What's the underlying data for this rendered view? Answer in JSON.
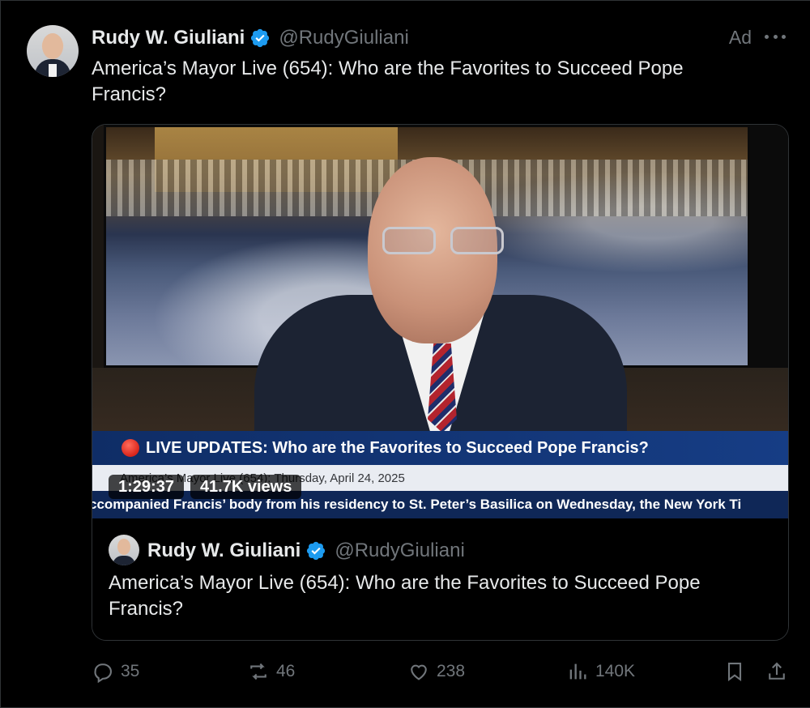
{
  "post": {
    "author_name": "Rudy W. Giuliani",
    "author_handle": "@RudyGiuliani",
    "ad_label": "Ad",
    "text": "America’s Mayor Live (654): Who are the Favorites to Succeed Pope Francis?"
  },
  "video": {
    "lower_third": "LIVE UPDATES: Who are the Favorites to Succeed Pope Francis?",
    "subline": "America’s Mayor Live (654): Thursday, April 24, 2025",
    "ticker": "ccompanied Francis’ body from his residency to St. Peter’s Basilica on Wednesday, the New York Ti",
    "duration": "1:29:37",
    "views": "41.7K views"
  },
  "quoted": {
    "author_name": "Rudy W. Giuliani",
    "author_handle": "@RudyGiuliani",
    "text": "America’s Mayor Live (654): Who are the Favorites to Succeed Pope Francis?"
  },
  "actions": {
    "replies": "35",
    "reposts": "46",
    "likes": "238",
    "views": "140K"
  },
  "colors": {
    "verified": "#1d9bf0",
    "muted": "#71767b",
    "text": "#e7e9ea",
    "background": "#000000",
    "border": "#2f3336"
  },
  "icons": [
    "verified-badge-icon",
    "more-icon",
    "reply-icon",
    "repost-icon",
    "like-icon",
    "views-icon",
    "bookmark-icon",
    "share-icon"
  ]
}
